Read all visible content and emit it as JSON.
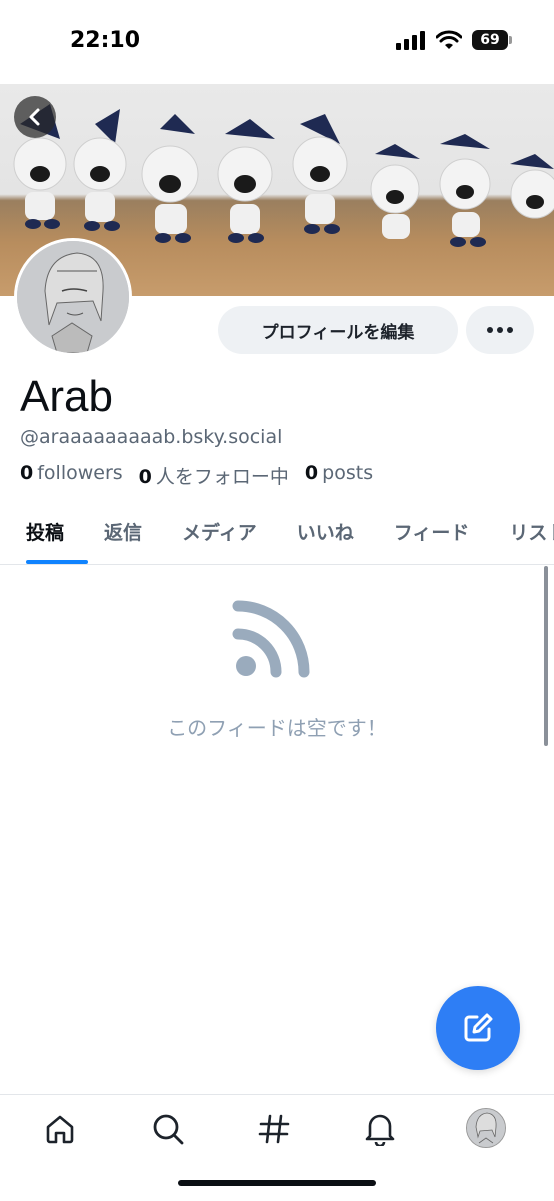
{
  "status_bar": {
    "time": "22:10",
    "battery": "69"
  },
  "profile": {
    "display_name": "Arab",
    "handle": "@araaaaaaaaab.bsky.social",
    "edit_label": "プロフィールを編集",
    "stats": {
      "followers_count": "0",
      "followers_label": "followers",
      "following_count": "0",
      "following_label": "人をフォロー中",
      "posts_count": "0",
      "posts_label": "posts"
    }
  },
  "tabs": [
    "投稿",
    "返信",
    "メディア",
    "いいね",
    "フィード",
    "リスト"
  ],
  "active_tab": "投稿",
  "feed": {
    "empty_message": "このフィードは空です！"
  },
  "bottom_nav": [
    "home-icon",
    "search-icon",
    "hashtag-icon",
    "bell-icon",
    "profile-avatar"
  ],
  "colors": {
    "accent": "#1083fe",
    "fab": "#2e7ef5",
    "muted": "#8fa0b3"
  }
}
